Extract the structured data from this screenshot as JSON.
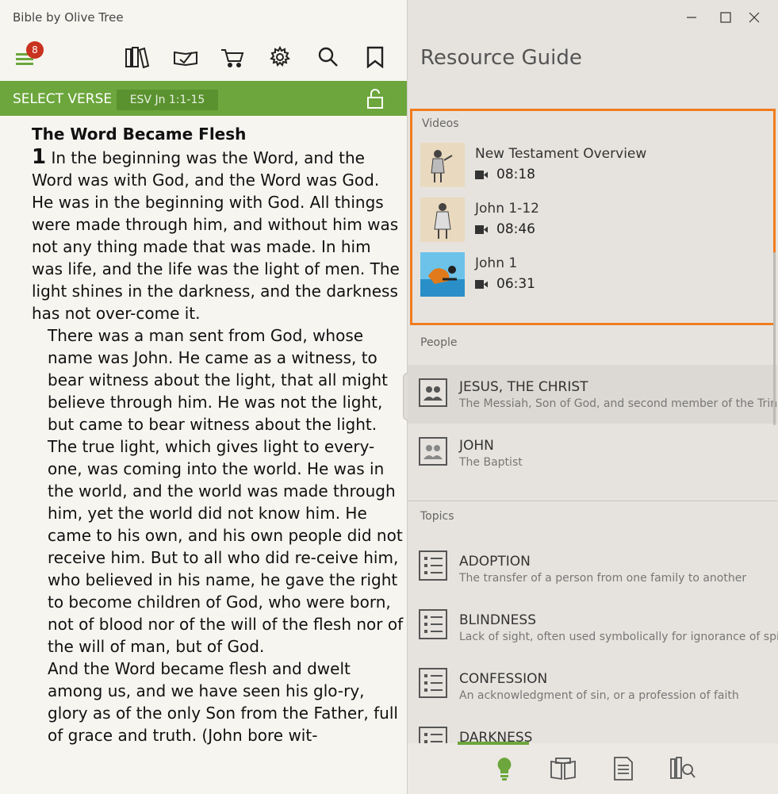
{
  "app": {
    "title": "Bible by Olive Tree",
    "menu_badge": "8"
  },
  "toolbar": {
    "icons": [
      "library-icon",
      "reading-plan-icon",
      "store-cart-icon",
      "settings-gear-icon",
      "search-icon",
      "bookmark-icon"
    ]
  },
  "verse_bar": {
    "select_label": "SELECT VERSE",
    "reference": "ESV Jn 1:1-15"
  },
  "passage": {
    "heading": "The Word Became Flesh",
    "chapter": "1",
    "paragraphs": [
      "In the beginning was the Word, and the Word was with God, and the Word was God. He was in the beginning with God. All things were made through him, and without him was not any thing made that was made. In him was life, and the life was the light of men. The light shines in the darkness, and the darkness has not over-come it.",
      "There was a man sent from God, whose name was John. He came as a witness, to bear witness about the light, that all might believe through him. He was not the light, but came to bear witness about the light.",
      "The true light, which gives light to every-one, was coming into the world. He was in the world, and the world was made through him, yet the world did not know him. He came to his own, and his own people did not receive him. But to all who did re-ceive him, who believed in his name, he gave the right to become children of God, who were born, not of blood nor of the will of the flesh nor of the will of man, but of God.",
      "And the Word became flesh and dwelt among us, and we have seen his glo-ry, glory as of the only Son from the Father, full of grace and truth. (John bore wit-"
    ]
  },
  "resource_guide": {
    "title": "Resource Guide",
    "videos_label": "Videos",
    "videos": [
      {
        "title": "New Testament Overview",
        "duration": "08:18"
      },
      {
        "title": "John 1-12",
        "duration": "08:46"
      },
      {
        "title": "John 1",
        "duration": "06:31"
      }
    ],
    "people_label": "People",
    "people": [
      {
        "name": "JESUS, THE CHRIST",
        "desc": "The Messiah, Son of God, and second member of the Trinit"
      },
      {
        "name": "JOHN",
        "desc": "The Baptist"
      }
    ],
    "topics_label": "Topics",
    "topics": [
      {
        "name": "ADOPTION",
        "desc": "The transfer of a person from one family to another"
      },
      {
        "name": "BLINDNESS",
        "desc": "Lack of sight, often used symbolically for ignorance of spiri"
      },
      {
        "name": "CONFESSION",
        "desc": "An acknowledgment of sin, or a profession of faith"
      },
      {
        "name": "DARKNESS",
        "desc": ""
      }
    ]
  },
  "colors": {
    "accent_green": "#6ca63c",
    "highlight_orange": "#f07c1e",
    "badge_red": "#c8321e"
  }
}
